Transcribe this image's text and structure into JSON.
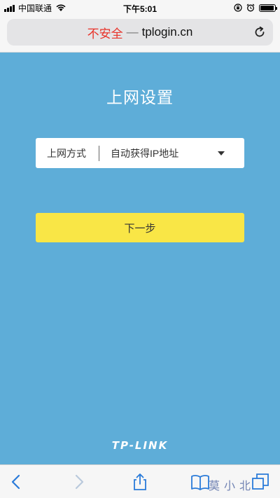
{
  "status_bar": {
    "carrier": "中国联通",
    "time": "下午5:01",
    "signal_bars": 4,
    "battery_level": 0.95
  },
  "address_bar": {
    "security_label": "不安全",
    "separator": "—",
    "domain": "tplogin.cn"
  },
  "page": {
    "background_color": "#5eadd8",
    "title": "上网设置",
    "connection_field": {
      "label": "上网方式",
      "selected_value": "自动获得IP地址"
    },
    "next_button_label": "下一步",
    "next_button_color": "#f9e646",
    "brand": "TP-LINK"
  },
  "toolbar": {
    "icons": [
      "back-icon",
      "forward-icon",
      "share-icon",
      "bookmarks-icon",
      "tabs-icon"
    ],
    "watermark": "莫小北"
  }
}
